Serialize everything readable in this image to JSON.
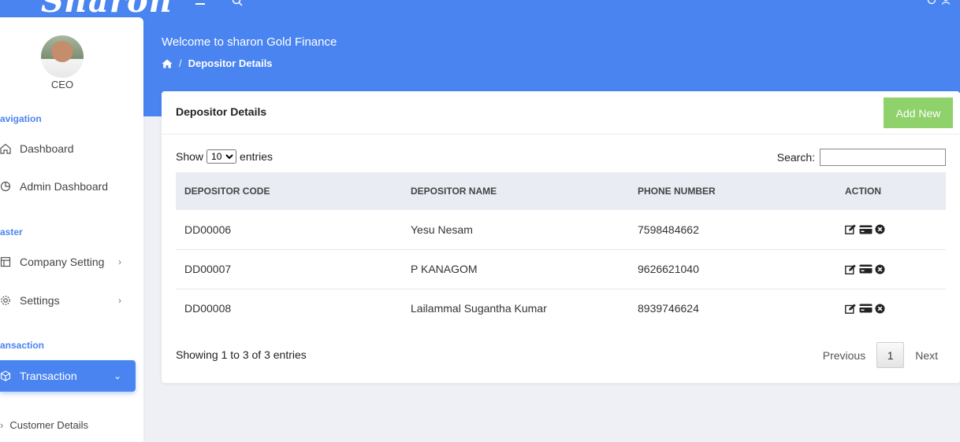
{
  "header": {
    "logo": "Sharon",
    "welcome": "Welcome to sharon Gold Finance",
    "breadcrumb_current": "Depositor Details"
  },
  "sidebar": {
    "role": "CEO",
    "sections": {
      "navigation": "avigation",
      "master": "aster",
      "transaction": "ansaction"
    },
    "items": [
      {
        "label": "Dashboard",
        "icon": "home-icon"
      },
      {
        "label": "Admin Dashboard",
        "icon": "pie-chart-icon"
      },
      {
        "label": "Company Setting",
        "icon": "layout-icon"
      },
      {
        "label": "Settings",
        "icon": "gear-icon"
      },
      {
        "label": "Transaction",
        "icon": "box-icon"
      }
    ],
    "sub_item": "Customer Details"
  },
  "card": {
    "title": "Depositor Details",
    "add_button": "Add New",
    "show_label": "Show",
    "entries_label": "entries",
    "page_size": "10",
    "search_label": "Search:",
    "search_value": ""
  },
  "table": {
    "headers": [
      "DEPOSITOR CODE",
      "DEPOSITOR NAME",
      "PHONE NUMBER",
      "ACTION"
    ],
    "rows": [
      {
        "code": "DD00006",
        "name": "Yesu Nesam",
        "phone": "7598484662"
      },
      {
        "code": "DD00007",
        "name": "P KANAGOM",
        "phone": "9626621040"
      },
      {
        "code": "DD00008",
        "name": "Lailammal Sugantha Kumar",
        "phone": "8939746624"
      }
    ]
  },
  "footer": {
    "showing": "Showing 1 to 3 of 3 entries",
    "previous": "Previous",
    "page": "1",
    "next": "Next"
  },
  "colors": {
    "primary": "#4a84f0",
    "add_button": "#8fd16a",
    "background": "#eef0f5"
  }
}
